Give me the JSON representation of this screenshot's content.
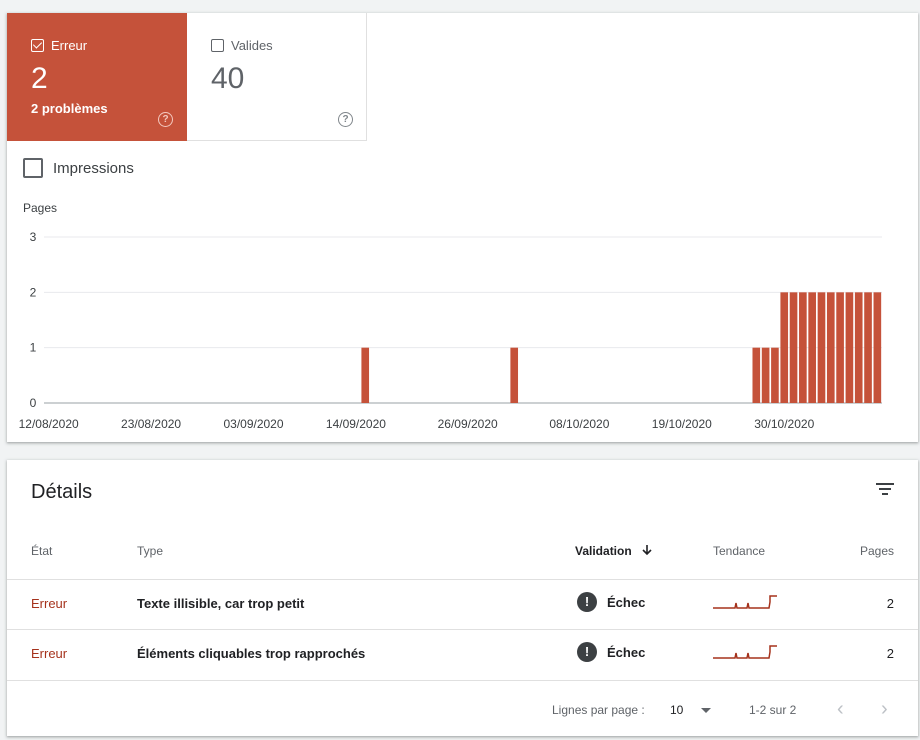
{
  "tiles": {
    "error": {
      "label": "Erreur",
      "count": "2",
      "sub": "2 problèmes",
      "help": "?"
    },
    "valid": {
      "label": "Valides",
      "count": "40",
      "help": "?"
    }
  },
  "impressions_label": "Impressions",
  "chart_data": {
    "type": "bar",
    "ylabel": "Pages",
    "ylim": [
      0,
      3
    ],
    "yticks": [
      "0",
      "1",
      "2",
      "3"
    ],
    "x_tick_labels": [
      "12/08/2020",
      "23/08/2020",
      "03/09/2020",
      "14/09/2020",
      "26/09/2020",
      "08/10/2020",
      "19/10/2020",
      "30/10/2020"
    ],
    "x_start": "12/08/2020",
    "x_end": "09/11/2020",
    "series": [
      {
        "color": "#c5523a",
        "points": [
          {
            "x": "15/09/2020",
            "y": 1
          },
          {
            "x": "01/10/2020",
            "y": 1
          },
          {
            "x": "27/10/2020",
            "y": 1
          },
          {
            "x": "28/10/2020",
            "y": 1
          },
          {
            "x": "29/10/2020",
            "y": 1
          },
          {
            "x": "30/10/2020",
            "y": 2
          },
          {
            "x": "31/10/2020",
            "y": 2
          },
          {
            "x": "01/11/2020",
            "y": 2
          },
          {
            "x": "02/11/2020",
            "y": 2
          },
          {
            "x": "03/11/2020",
            "y": 2
          },
          {
            "x": "04/11/2020",
            "y": 2
          },
          {
            "x": "05/11/2020",
            "y": 2
          },
          {
            "x": "06/11/2020",
            "y": 2
          },
          {
            "x": "07/11/2020",
            "y": 2
          },
          {
            "x": "08/11/2020",
            "y": 2
          },
          {
            "x": "09/11/2020",
            "y": 2
          }
        ]
      }
    ]
  },
  "details": {
    "title": "Détails",
    "columns": {
      "state": "État",
      "type": "Type",
      "validation": "Validation",
      "trend": "Tendance",
      "pages": "Pages"
    },
    "rows": [
      {
        "state": "Erreur",
        "type": "Texte illisible, car trop petit",
        "validation": "Échec",
        "pages": "2"
      },
      {
        "state": "Erreur",
        "type": "Éléments cliquables trop rapprochés",
        "validation": "Échec",
        "pages": "2"
      }
    ],
    "footer": {
      "rows_per_page_label": "Lignes par page :",
      "rows_per_page": "10",
      "range": "1-2 sur 2"
    }
  },
  "colors": {
    "error": "#c5523a",
    "error_text": "#a5321c"
  }
}
